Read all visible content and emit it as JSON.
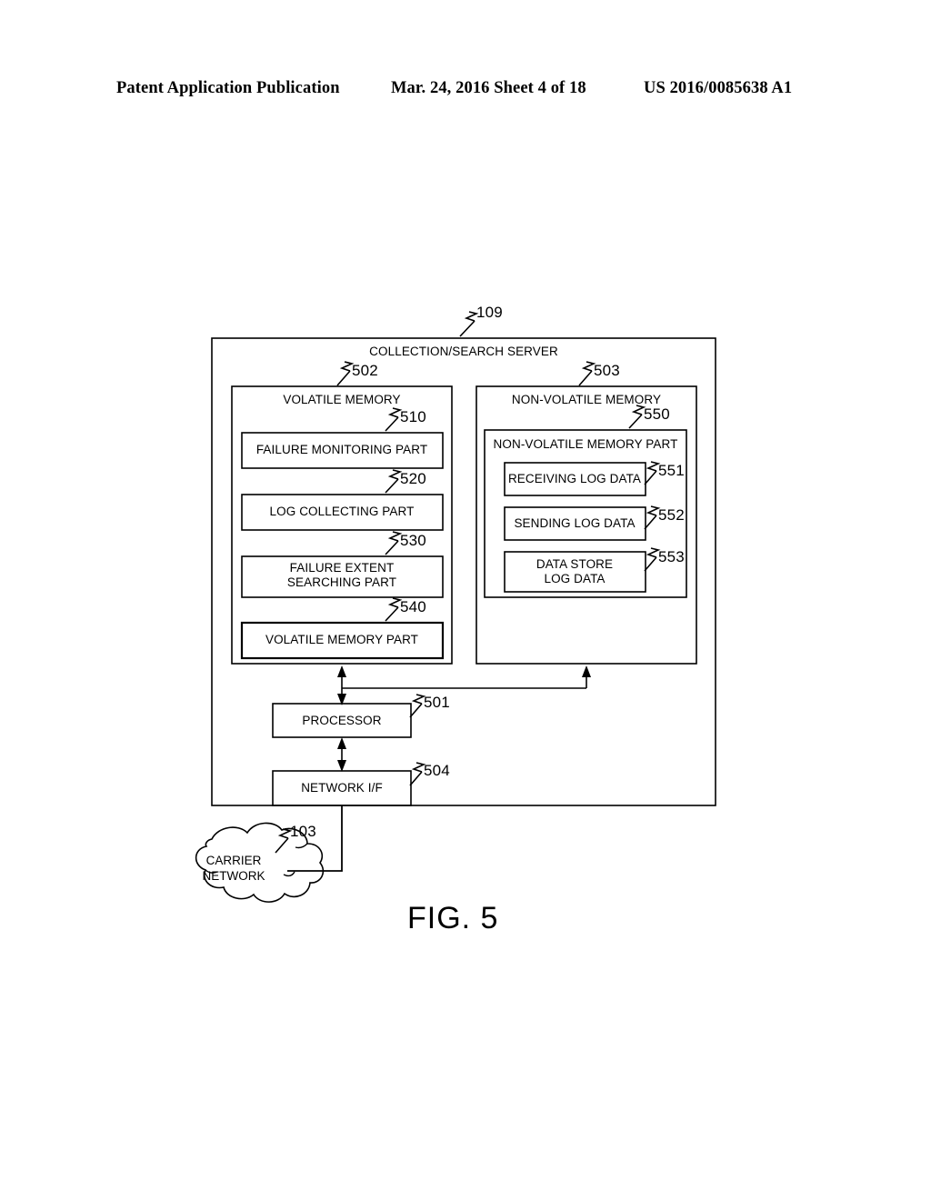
{
  "header": {
    "left": "Patent Application Publication",
    "middle": "Mar. 24, 2016  Sheet 4 of 18",
    "right": "US 2016/0085638 A1"
  },
  "figure": {
    "caption": "FIG. 5",
    "server": {
      "ref": "109",
      "title": "COLLECTION/SEARCH SERVER"
    },
    "volatile_memory": {
      "ref": "502",
      "title": "VOLATILE MEMORY",
      "parts": [
        {
          "ref": "510",
          "label": "FAILURE MONITORING PART"
        },
        {
          "ref": "520",
          "label": "LOG COLLECTING PART"
        },
        {
          "ref": "530",
          "label": "FAILURE EXTENT\nSEARCHING PART"
        },
        {
          "ref": "540",
          "label": "VOLATILE MEMORY PART"
        }
      ]
    },
    "non_volatile_memory": {
      "ref": "503",
      "title": "NON-VOLATILE MEMORY",
      "part": {
        "ref": "550",
        "title": "NON-VOLATILE MEMORY PART",
        "items": [
          {
            "ref": "551",
            "label": "RECEIVING LOG DATA"
          },
          {
            "ref": "552",
            "label": "SENDING LOG DATA"
          },
          {
            "ref": "553",
            "label": "DATA STORE\nLOG DATA"
          }
        ]
      }
    },
    "processor": {
      "ref": "501",
      "label": "PROCESSOR"
    },
    "network_if": {
      "ref": "504",
      "label": "NETWORK I/F"
    },
    "carrier_network": {
      "ref": "103",
      "label": "CARRIER\nNETWORK"
    }
  }
}
